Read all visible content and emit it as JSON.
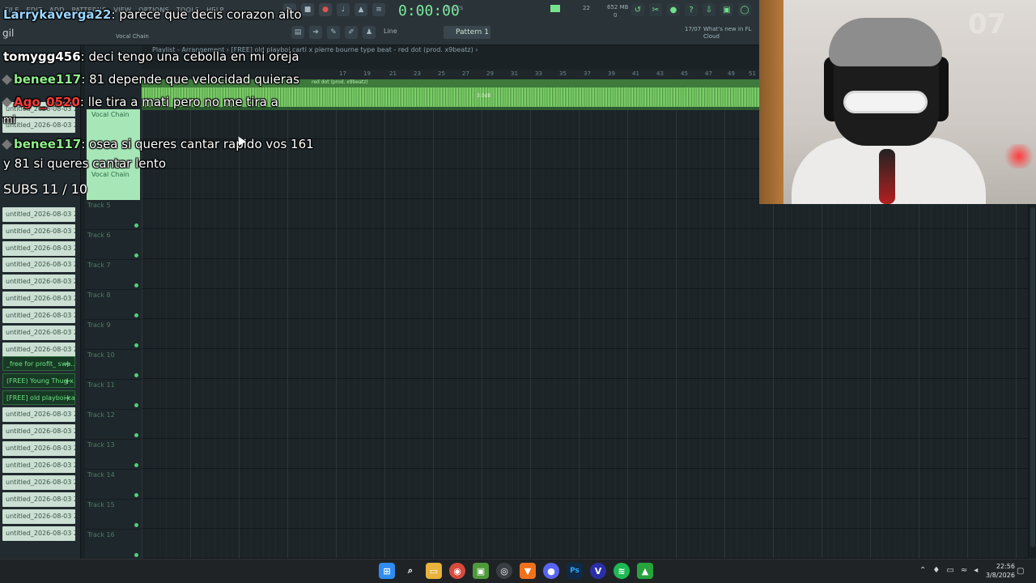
{
  "toolbar": {
    "menu": [
      "FILE",
      "EDIT",
      "ADD",
      "PATTERNS",
      "VIEW",
      "OPTIONS",
      "TOOLS",
      "HELP"
    ],
    "time": "0:00:00",
    "time_unit": "M:S:CS",
    "cpu": "22",
    "memory": "652 MB",
    "memory_sub": "0",
    "pattern": "Pattern 1",
    "snap": "Line",
    "news_count": "17/07",
    "news_text": "What's new in FL Cloud",
    "chain_label": "Vocal Chain",
    "gil_label": "gil"
  },
  "playlist": {
    "title": "Playlist - Arrangement › [FREE] old playboi carti x pierre bourne type beat - red dot (prod. x9beatz) ›",
    "clip_name": "red dot (prod. x9beatz)",
    "clip_db": "3.0dB",
    "ruler": [
      "17",
      "19",
      "21",
      "23",
      "25",
      "27",
      "29",
      "31",
      "33",
      "35",
      "37",
      "39",
      "41",
      "43",
      "45",
      "47",
      "49",
      "51"
    ],
    "tracks": [
      "Track 5",
      "Track 6",
      "Track 7",
      "Track 8",
      "Track 9",
      "Track 10",
      "Track 11",
      "Track 12",
      "Track 13",
      "Track 14",
      "Track 15",
      "Track 16"
    ],
    "vocal_labels": [
      "Vocal Chain",
      "Vocal Chain"
    ]
  },
  "browser": {
    "items": [
      "untitled_2026-08-03 22-...",
      "untitled_2026-08-03 22-...",
      "untitled_2026-08-03 22-...",
      "untitled_2026-08-03 22-...",
      "untitled_2026-08-03 22-...",
      "untitled_2026-08-03 22-...",
      "untitled_2026-08-03 22-...",
      "untitled_2026-08-03 22-...",
      "untitled_2026-08-03 22-...",
      "untitled_2026-08-03 22-...",
      "untitled_2026-08-03 22-..."
    ],
    "highlighted": [
      "_free for profit_ swa...",
      "(FREE) Young Thug x...",
      "[FREE] old playboi ca..."
    ],
    "items_bottom": [
      "untitled_2026-08-03 22-...",
      "untitled_2026-08-03 22-...",
      "untitled_2026-08-03 22-...",
      "untitled_2026-08-03 22-...",
      "untitled_2026-08-03 22-...",
      "untitled_2026-08-03 22-...",
      "untitled_2026-08-03 22-...",
      "untitled_2026-08-03 22-..."
    ]
  },
  "chat": {
    "messages": [
      {
        "user": "Larrykaverga22",
        "text": "parece que decis corazon alto"
      },
      {
        "user": "tomygg456",
        "text": "deci tengo una cebolla en mi oreja"
      },
      {
        "user": "benee117",
        "text": "81 depende que velocidad quieras"
      },
      {
        "user": "Ago_0520",
        "text": "lle tira a mati pero no me tira a"
      },
      {
        "user": "benee117",
        "text": "osea si queres cantar rapido vos 161"
      }
    ],
    "continuation_a": "mi",
    "continuation": "y 81 si queres cantar lento",
    "subs": "SUBS 11 / 10"
  },
  "webcam": {
    "wall_text": "07"
  },
  "taskbar": {
    "icons": [
      "windows-icon",
      "search-icon",
      "file-explorer-icon",
      "chrome-icon",
      "minecraft-icon",
      "obs-icon",
      "brave-icon",
      "discord-icon",
      "photoshop-icon",
      "vegas-icon",
      "spotify-icon",
      "fl-studio-icon"
    ],
    "time": "22:56",
    "date": "3/8/2026"
  },
  "colors": {
    "accent_green": "#76e38c",
    "clip_green": "#7fd86d",
    "background": "#1c2428"
  }
}
